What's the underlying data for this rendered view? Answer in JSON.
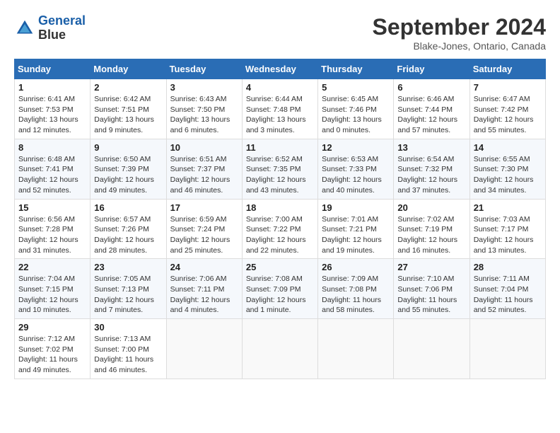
{
  "header": {
    "logo_line1": "General",
    "logo_line2": "Blue",
    "month_year": "September 2024",
    "location": "Blake-Jones, Ontario, Canada"
  },
  "columns": [
    "Sunday",
    "Monday",
    "Tuesday",
    "Wednesday",
    "Thursday",
    "Friday",
    "Saturday"
  ],
  "weeks": [
    [
      {
        "day": "1",
        "sunrise": "6:41 AM",
        "sunset": "7:53 PM",
        "daylight": "13 hours and 12 minutes."
      },
      {
        "day": "2",
        "sunrise": "6:42 AM",
        "sunset": "7:51 PM",
        "daylight": "13 hours and 9 minutes."
      },
      {
        "day": "3",
        "sunrise": "6:43 AM",
        "sunset": "7:50 PM",
        "daylight": "13 hours and 6 minutes."
      },
      {
        "day": "4",
        "sunrise": "6:44 AM",
        "sunset": "7:48 PM",
        "daylight": "13 hours and 3 minutes."
      },
      {
        "day": "5",
        "sunrise": "6:45 AM",
        "sunset": "7:46 PM",
        "daylight": "13 hours and 0 minutes."
      },
      {
        "day": "6",
        "sunrise": "6:46 AM",
        "sunset": "7:44 PM",
        "daylight": "12 hours and 57 minutes."
      },
      {
        "day": "7",
        "sunrise": "6:47 AM",
        "sunset": "7:42 PM",
        "daylight": "12 hours and 55 minutes."
      }
    ],
    [
      {
        "day": "8",
        "sunrise": "6:48 AM",
        "sunset": "7:41 PM",
        "daylight": "12 hours and 52 minutes."
      },
      {
        "day": "9",
        "sunrise": "6:50 AM",
        "sunset": "7:39 PM",
        "daylight": "12 hours and 49 minutes."
      },
      {
        "day": "10",
        "sunrise": "6:51 AM",
        "sunset": "7:37 PM",
        "daylight": "12 hours and 46 minutes."
      },
      {
        "day": "11",
        "sunrise": "6:52 AM",
        "sunset": "7:35 PM",
        "daylight": "12 hours and 43 minutes."
      },
      {
        "day": "12",
        "sunrise": "6:53 AM",
        "sunset": "7:33 PM",
        "daylight": "12 hours and 40 minutes."
      },
      {
        "day": "13",
        "sunrise": "6:54 AM",
        "sunset": "7:32 PM",
        "daylight": "12 hours and 37 minutes."
      },
      {
        "day": "14",
        "sunrise": "6:55 AM",
        "sunset": "7:30 PM",
        "daylight": "12 hours and 34 minutes."
      }
    ],
    [
      {
        "day": "15",
        "sunrise": "6:56 AM",
        "sunset": "7:28 PM",
        "daylight": "12 hours and 31 minutes."
      },
      {
        "day": "16",
        "sunrise": "6:57 AM",
        "sunset": "7:26 PM",
        "daylight": "12 hours and 28 minutes."
      },
      {
        "day": "17",
        "sunrise": "6:59 AM",
        "sunset": "7:24 PM",
        "daylight": "12 hours and 25 minutes."
      },
      {
        "day": "18",
        "sunrise": "7:00 AM",
        "sunset": "7:22 PM",
        "daylight": "12 hours and 22 minutes."
      },
      {
        "day": "19",
        "sunrise": "7:01 AM",
        "sunset": "7:21 PM",
        "daylight": "12 hours and 19 minutes."
      },
      {
        "day": "20",
        "sunrise": "7:02 AM",
        "sunset": "7:19 PM",
        "daylight": "12 hours and 16 minutes."
      },
      {
        "day": "21",
        "sunrise": "7:03 AM",
        "sunset": "7:17 PM",
        "daylight": "12 hours and 13 minutes."
      }
    ],
    [
      {
        "day": "22",
        "sunrise": "7:04 AM",
        "sunset": "7:15 PM",
        "daylight": "12 hours and 10 minutes."
      },
      {
        "day": "23",
        "sunrise": "7:05 AM",
        "sunset": "7:13 PM",
        "daylight": "12 hours and 7 minutes."
      },
      {
        "day": "24",
        "sunrise": "7:06 AM",
        "sunset": "7:11 PM",
        "daylight": "12 hours and 4 minutes."
      },
      {
        "day": "25",
        "sunrise": "7:08 AM",
        "sunset": "7:09 PM",
        "daylight": "12 hours and 1 minute."
      },
      {
        "day": "26",
        "sunrise": "7:09 AM",
        "sunset": "7:08 PM",
        "daylight": "11 hours and 58 minutes."
      },
      {
        "day": "27",
        "sunrise": "7:10 AM",
        "sunset": "7:06 PM",
        "daylight": "11 hours and 55 minutes."
      },
      {
        "day": "28",
        "sunrise": "7:11 AM",
        "sunset": "7:04 PM",
        "daylight": "11 hours and 52 minutes."
      }
    ],
    [
      {
        "day": "29",
        "sunrise": "7:12 AM",
        "sunset": "7:02 PM",
        "daylight": "11 hours and 49 minutes."
      },
      {
        "day": "30",
        "sunrise": "7:13 AM",
        "sunset": "7:00 PM",
        "daylight": "11 hours and 46 minutes."
      },
      null,
      null,
      null,
      null,
      null
    ]
  ]
}
